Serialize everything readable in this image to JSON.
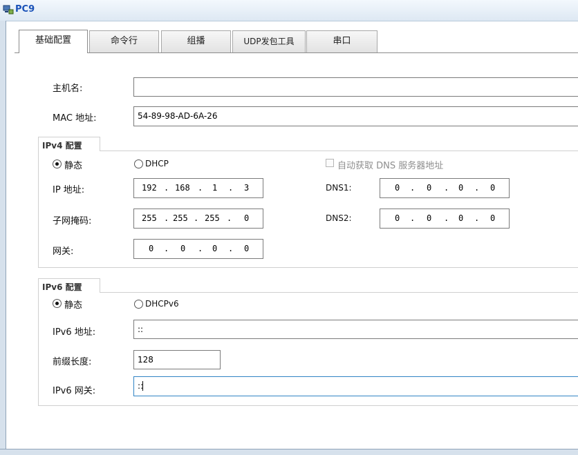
{
  "window": {
    "title": "PC9",
    "icon": "pc-icon"
  },
  "tabs": [
    {
      "label": "基础配置",
      "active": true
    },
    {
      "label": "命令行",
      "active": false
    },
    {
      "label": "组播",
      "active": false
    },
    {
      "label": "UDP发包工具",
      "active": false
    },
    {
      "label": "串口",
      "active": false
    }
  ],
  "basic": {
    "hostname_label": "主机名:",
    "hostname_value": "",
    "mac_label": "MAC 地址:",
    "mac_value": "54-89-98-AD-6A-26"
  },
  "ipv4": {
    "group_title": "IPv4 配置",
    "static_label": "静态",
    "static_selected": true,
    "dhcp_label": "DHCP",
    "auto_dns_label": "自动获取 DNS 服务器地址",
    "auto_dns_checked": false,
    "ip_label": "IP 地址:",
    "ip": [
      "192",
      "168",
      "1",
      "3"
    ],
    "mask_label": "子网掩码:",
    "mask": [
      "255",
      "255",
      "255",
      "0"
    ],
    "gateway_label": "网关:",
    "gateway": [
      "0",
      "0",
      "0",
      "0"
    ],
    "dns1_label": "DNS1:",
    "dns1": [
      "0",
      "0",
      "0",
      "0"
    ],
    "dns2_label": "DNS2:",
    "dns2": [
      "0",
      "0",
      "0",
      "0"
    ]
  },
  "ipv6": {
    "group_title": "IPv6 配置",
    "static_label": "静态",
    "static_selected": true,
    "dhcp_label": "DHCPv6",
    "addr_label": "IPv6 地址:",
    "addr_value": "::",
    "prefix_label": "前缀长度:",
    "prefix_value": "128",
    "gateway_label": "IPv6 网关:",
    "gateway_value": "::"
  }
}
